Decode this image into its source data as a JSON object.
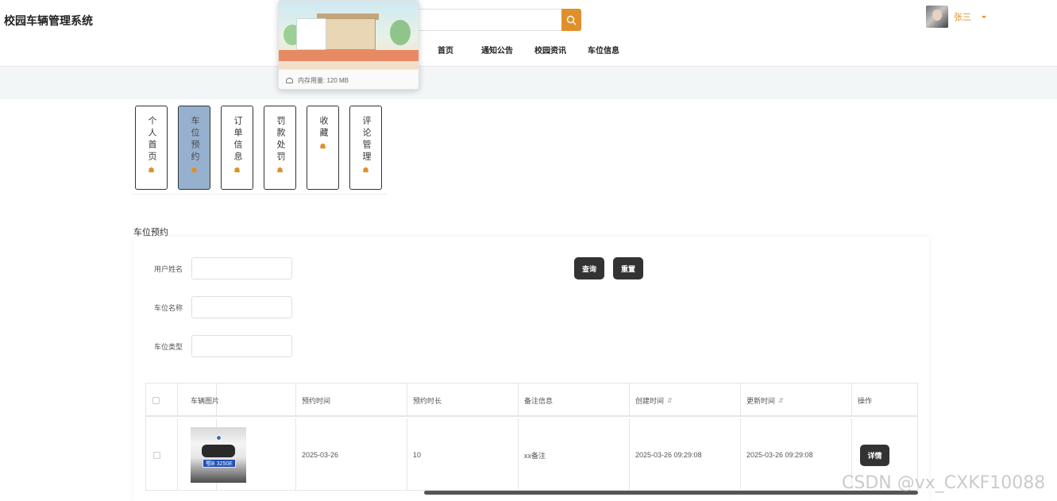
{
  "header": {
    "brand": "校园车辆管理系统",
    "search_placeholder": "",
    "nav": [
      "首页",
      "通知公告",
      "校园资讯",
      "车位信息"
    ],
    "username": "张三",
    "accent_color": "#e0902b"
  },
  "popup": {
    "memory_text": "内存用量: 120 MB"
  },
  "vertical_tabs": [
    {
      "label": "个人首页",
      "icon": "home-icon",
      "active": false
    },
    {
      "label": "车位预约",
      "icon": "home-icon",
      "active": true
    },
    {
      "label": "订单信息",
      "icon": "home-icon",
      "active": false
    },
    {
      "label": "罚款处罚",
      "icon": "home-icon",
      "active": false
    },
    {
      "label": "收藏",
      "icon": "home-icon",
      "active": false
    },
    {
      "label": "评论管理",
      "icon": "home-icon",
      "active": false
    }
  ],
  "section_title": "车位预约",
  "search_form": {
    "fields": [
      {
        "label": "用户姓名",
        "value": ""
      },
      {
        "label": "车位名称",
        "value": ""
      },
      {
        "label": "车位类型",
        "value": ""
      }
    ],
    "query_label": "查询",
    "reset_label": "重置"
  },
  "table": {
    "columns": [
      "车辆图片",
      "预约时间",
      "预约时长",
      "备注信息",
      "创建时间",
      "更新时间",
      "操作"
    ],
    "rows": [
      {
        "plate": "鄂B 3250E",
        "reserve_time": "2025-03-26",
        "duration": "10",
        "remark": "xx备注",
        "created": "2025-03-26 09:29:08",
        "updated": "2025-03-26 09:29:08",
        "action_label": "详情"
      }
    ]
  },
  "watermark": "CSDN @vx_CXKF10088"
}
